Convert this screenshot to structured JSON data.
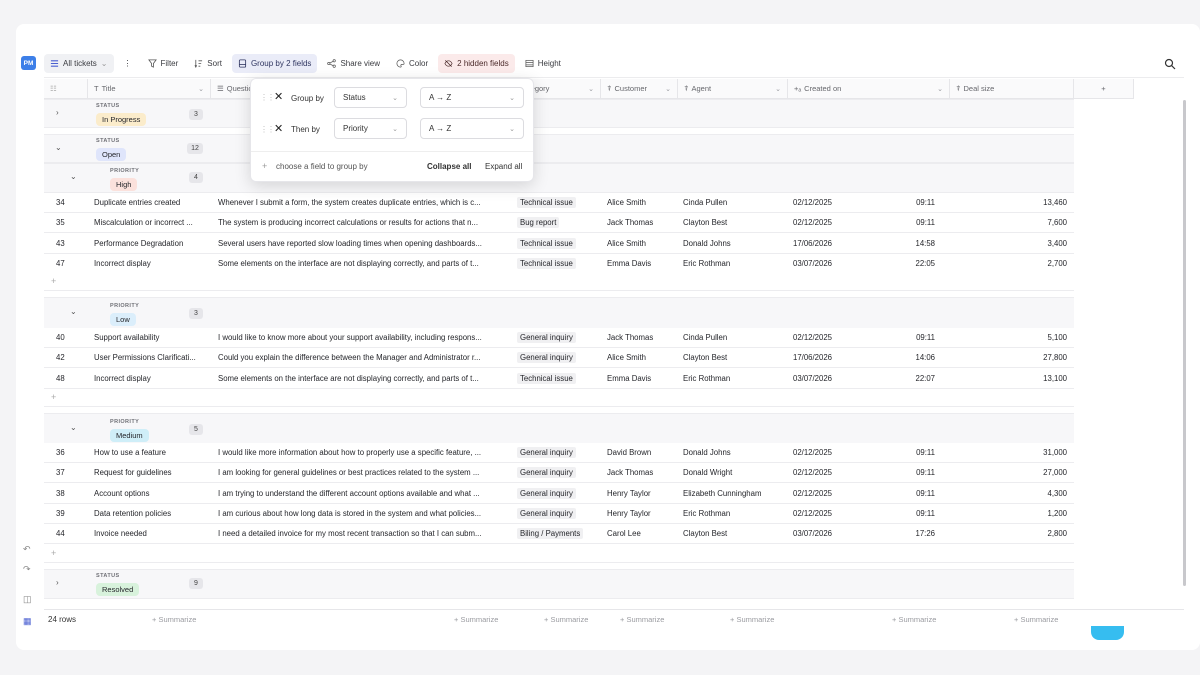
{
  "workspace_badge": "PM",
  "toolbar": {
    "view_label": "All tickets",
    "filter_label": "Filter",
    "sort_label": "Sort",
    "group_label": "Group by 2 fields",
    "share_label": "Share view",
    "color_label": "Color",
    "hidden_label": "2 hidden fields",
    "height_label": "Height"
  },
  "columns": [
    "Title",
    "Question",
    "Category",
    "Customer",
    "Agent",
    "Created on",
    "Deal size"
  ],
  "popup": {
    "row1_label": "Group by",
    "row1_field": "Status",
    "row1_order": "A → Z",
    "row2_label": "Then by",
    "row2_field": "Priority",
    "row2_order": "A → Z",
    "choose_label": "choose a field to group by",
    "collapse_label": "Collapse all",
    "expand_label": "Expand all"
  },
  "groups": {
    "in_progress": {
      "label": "STATUS",
      "value": "In Progress",
      "count": "3"
    },
    "open": {
      "label": "STATUS",
      "value": "Open",
      "count": "12"
    },
    "high": {
      "label": "PRIORITY",
      "value": "High",
      "count": "4"
    },
    "low": {
      "label": "PRIORITY",
      "value": "Low",
      "count": "3"
    },
    "medium": {
      "label": "PRIORITY",
      "value": "Medium",
      "count": "5"
    },
    "resolved": {
      "label": "STATUS",
      "value": "Resolved",
      "count": "9"
    }
  },
  "high_rows": [
    {
      "id": "34",
      "title": "Duplicate entries created",
      "q": "Whenever I submit a form, the system creates duplicate entries, which is c...",
      "cat": "Technical issue",
      "cust": "Alice Smith",
      "agent": "Cinda Pullen",
      "date": "02/12/2025",
      "time": "09:11",
      "deal": "13,460"
    },
    {
      "id": "35",
      "title": "Miscalculation or incorrect ...",
      "q": "The system is producing incorrect calculations or results for actions that n...",
      "cat": "Bug report",
      "cust": "Jack Thomas",
      "agent": "Clayton Best",
      "date": "02/12/2025",
      "time": "09:11",
      "deal": "7,600"
    },
    {
      "id": "43",
      "title": "Performance Degradation",
      "q": "Several users have reported slow loading times when opening dashboards...",
      "cat": "Technical issue",
      "cust": "Alice Smith",
      "agent": "Donald Johns",
      "date": "17/06/2026",
      "time": "14:58",
      "deal": "3,400"
    },
    {
      "id": "47",
      "title": "Incorrect display",
      "q": "Some elements on the interface are not displaying correctly, and parts of t...",
      "cat": "Technical issue",
      "cust": "Emma Davis",
      "agent": "Eric Rothman",
      "date": "03/07/2026",
      "time": "22:05",
      "deal": "2,700"
    }
  ],
  "low_rows": [
    {
      "id": "40",
      "title": "Support availability",
      "q": "I would like to know more about your support availability, including respons...",
      "cat": "General inquiry",
      "cust": "Jack Thomas",
      "agent": "Cinda Pullen",
      "date": "02/12/2025",
      "time": "09:11",
      "deal": "5,100"
    },
    {
      "id": "42",
      "title": "User Permissions Clarificati...",
      "q": "Could you explain the difference between the Manager and Administrator r...",
      "cat": "General inquiry",
      "cust": "Alice Smith",
      "agent": "Clayton Best",
      "date": "17/06/2026",
      "time": "14:06",
      "deal": "27,800"
    },
    {
      "id": "48",
      "title": "Incorrect display",
      "q": "Some elements on the interface are not displaying correctly, and parts of t...",
      "cat": "Technical issue",
      "cust": "Emma Davis",
      "agent": "Eric Rothman",
      "date": "03/07/2026",
      "time": "22:07",
      "deal": "13,100"
    }
  ],
  "medium_rows": [
    {
      "id": "36",
      "title": "How to use a feature",
      "q": "I would like more information about how to properly use a specific feature, ...",
      "cat": "General inquiry",
      "cust": "David Brown",
      "agent": "Donald Johns",
      "date": "02/12/2025",
      "time": "09:11",
      "deal": "31,000"
    },
    {
      "id": "37",
      "title": "Request for guidelines",
      "q": "I am looking for general guidelines or best practices related to the system ...",
      "cat": "General inquiry",
      "cust": "Jack Thomas",
      "agent": "Donald Wright",
      "date": "02/12/2025",
      "time": "09:11",
      "deal": "27,000"
    },
    {
      "id": "38",
      "title": "Account options",
      "q": "I am trying to understand the different account options available and what ...",
      "cat": "General inquiry",
      "cust": "Henry Taylor",
      "agent": "Elizabeth Cunningham",
      "date": "02/12/2025",
      "time": "09:11",
      "deal": "4,300"
    },
    {
      "id": "39",
      "title": "Data retention policies",
      "q": "I am curious about how long data is stored in the system and what policies...",
      "cat": "General inquiry",
      "cust": "Henry Taylor",
      "agent": "Eric Rothman",
      "date": "02/12/2025",
      "time": "09:11",
      "deal": "1,200"
    },
    {
      "id": "44",
      "title": "Invoice needed",
      "q": "I need a detailed invoice for my most recent transaction so that I can subm...",
      "cat": "Biling / Payments",
      "cust": "Carol Lee",
      "agent": "Clayton Best",
      "date": "03/07/2026",
      "time": "17:26",
      "deal": "2,800"
    }
  ],
  "footer": {
    "rows": "24 rows",
    "summarize": "Summarize"
  },
  "colors": {
    "accent": "#4a5fd1",
    "in_progress": "#fbeccb",
    "open": "#dfe5fb",
    "high": "#fbe1dc",
    "low": "#dbeefb",
    "medium": "#cfeef8",
    "resolved": "#d8f2dc"
  }
}
